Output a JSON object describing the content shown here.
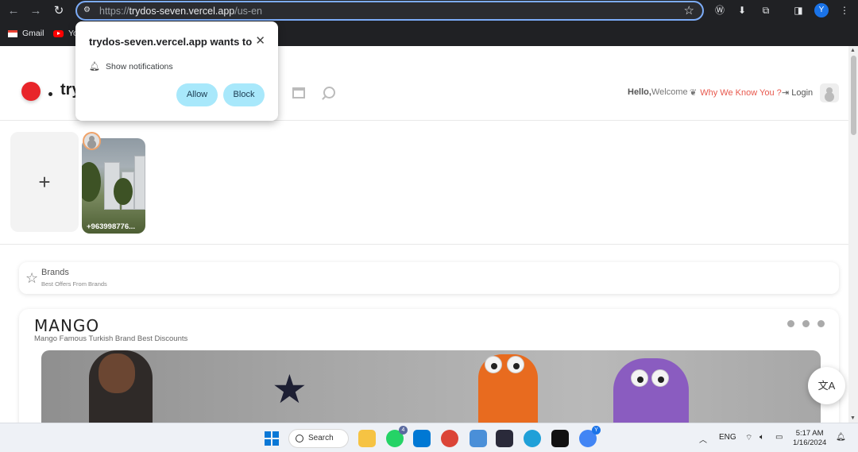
{
  "browser": {
    "url_scheme": "https://",
    "url_host": "trydos-seven.vercel.app",
    "url_path": "/us-en",
    "profile_initial": "Y",
    "bookmarks": [
      "Gmail",
      "Yo"
    ]
  },
  "permission_popup": {
    "title": "trydos-seven.vercel.app wants to",
    "permission": "Show notifications",
    "allow_label": "Allow",
    "block_label": "Block",
    "close_glyph": "✕"
  },
  "site": {
    "logo_text": "try",
    "greeting_bold": "Hello,",
    "greeting": "Welcome",
    "why_label": "Why We Know You ?",
    "login_label": "Login"
  },
  "stories": {
    "add_glyph": "+",
    "story_label": "+963998776..."
  },
  "brands": {
    "title": "Brands",
    "subtitle": "Best Offers From Brands"
  },
  "mango": {
    "logo": "MANGO",
    "subtitle": "Mango Famous Turkish Brand Best Discounts"
  },
  "taskbar": {
    "search_label": "Search",
    "whatsapp_badge": "4",
    "chrome_badge": "Y",
    "language": "ENG",
    "time": "5:17 AM",
    "date": "1/16/2024"
  },
  "colors": {
    "browser_bg": "#202124",
    "popup_button": "#a8e8fb",
    "brand_red": "#e8252a",
    "why_link": "#e8584d"
  }
}
